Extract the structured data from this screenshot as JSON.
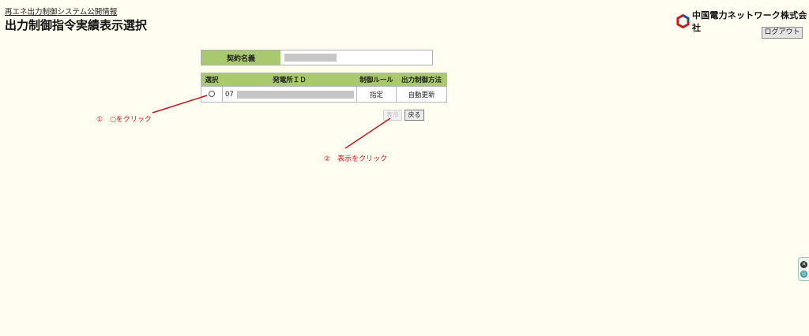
{
  "header": {
    "subtitle": "再エネ出力制御システム公開情報",
    "title": "出力制御指令実績表示選択"
  },
  "logo": {
    "company": "中国電力ネットワーク株式会社"
  },
  "logout_label": "ログアウト",
  "contract": {
    "label": "契約名義",
    "value_redacted": true
  },
  "table": {
    "headers": [
      "選択",
      "発電所ＩＤ",
      "制御ルール",
      "出力制御方法"
    ],
    "rows": [
      {
        "plant_id_prefix": "07",
        "rule": "指定",
        "method": "自動更新"
      }
    ]
  },
  "buttons": {
    "show": "表示",
    "back": "戻る"
  },
  "annotations": {
    "step1": "①　○をクリック",
    "step2": "②　表示をクリック",
    "color": "#c8141c"
  },
  "colors": {
    "header_green": "#a8c96e",
    "background": "#fffef0"
  }
}
